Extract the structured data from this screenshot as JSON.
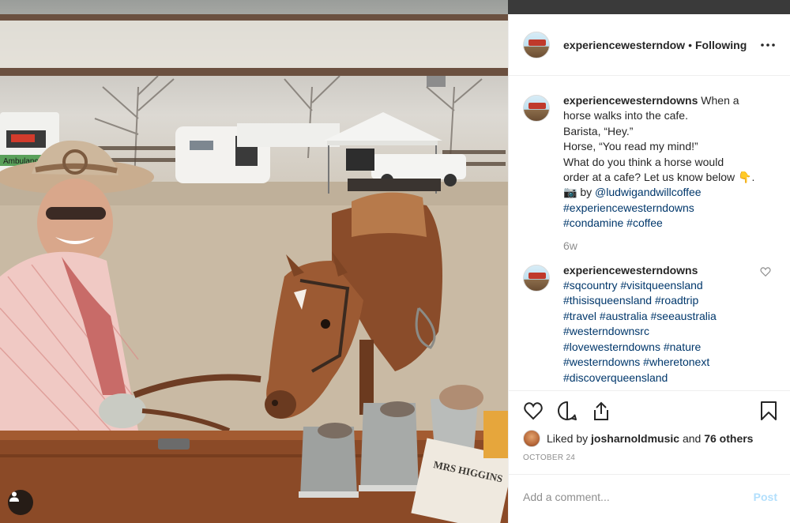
{
  "post": {
    "username": "experiencewesterndow",
    "separator": "•",
    "follow_status": "Following"
  },
  "caption": {
    "username": "experiencewesterndowns",
    "lines": [
      "When a",
      "horse walks into the cafe.",
      "Barista, “Hey.”",
      "Horse, “You read my mind!”",
      "What do you think a horse would",
      "order at a cafe? Let us know below 👇.",
      "📷 by "
    ],
    "mention": "@ludwigandwillcoffee",
    "hashtags": [
      "#experiencewesterndowns",
      "#condamine",
      "#coffee"
    ],
    "age": "6w"
  },
  "comment": {
    "username": "experiencewesterndowns",
    "hashtags": [
      "#sqcountry",
      "#visitqueensland",
      "#thisisqueensland",
      "#roadtrip",
      "#travel",
      "#australia",
      "#seeaustralia",
      "#westerndownsrc",
      "#lovewesterndowns",
      "#nature",
      "#westerndowns",
      "#wheretonext",
      "#discoverqueensland"
    ]
  },
  "likes": {
    "prefix": "Liked by",
    "user": "josharnoldmusic",
    "middle": "and",
    "others": "76 others"
  },
  "date": "OCTOBER 24",
  "add_comment": {
    "placeholder": "Add a comment...",
    "post_label": "Post"
  },
  "photo": {
    "ambulance_label": "Ambulance",
    "cup_label": "MRS HIGGINS"
  },
  "icons": {
    "heart": "heart-icon",
    "comment": "comment-icon",
    "share": "share-icon",
    "save": "bookmark-icon",
    "more": "more-icon",
    "user_tag": "user-tag-icon"
  },
  "colors": {
    "text": "#262626",
    "link": "#00376b",
    "muted": "#8e8e8e",
    "post_disabled": "#b2dffc"
  }
}
